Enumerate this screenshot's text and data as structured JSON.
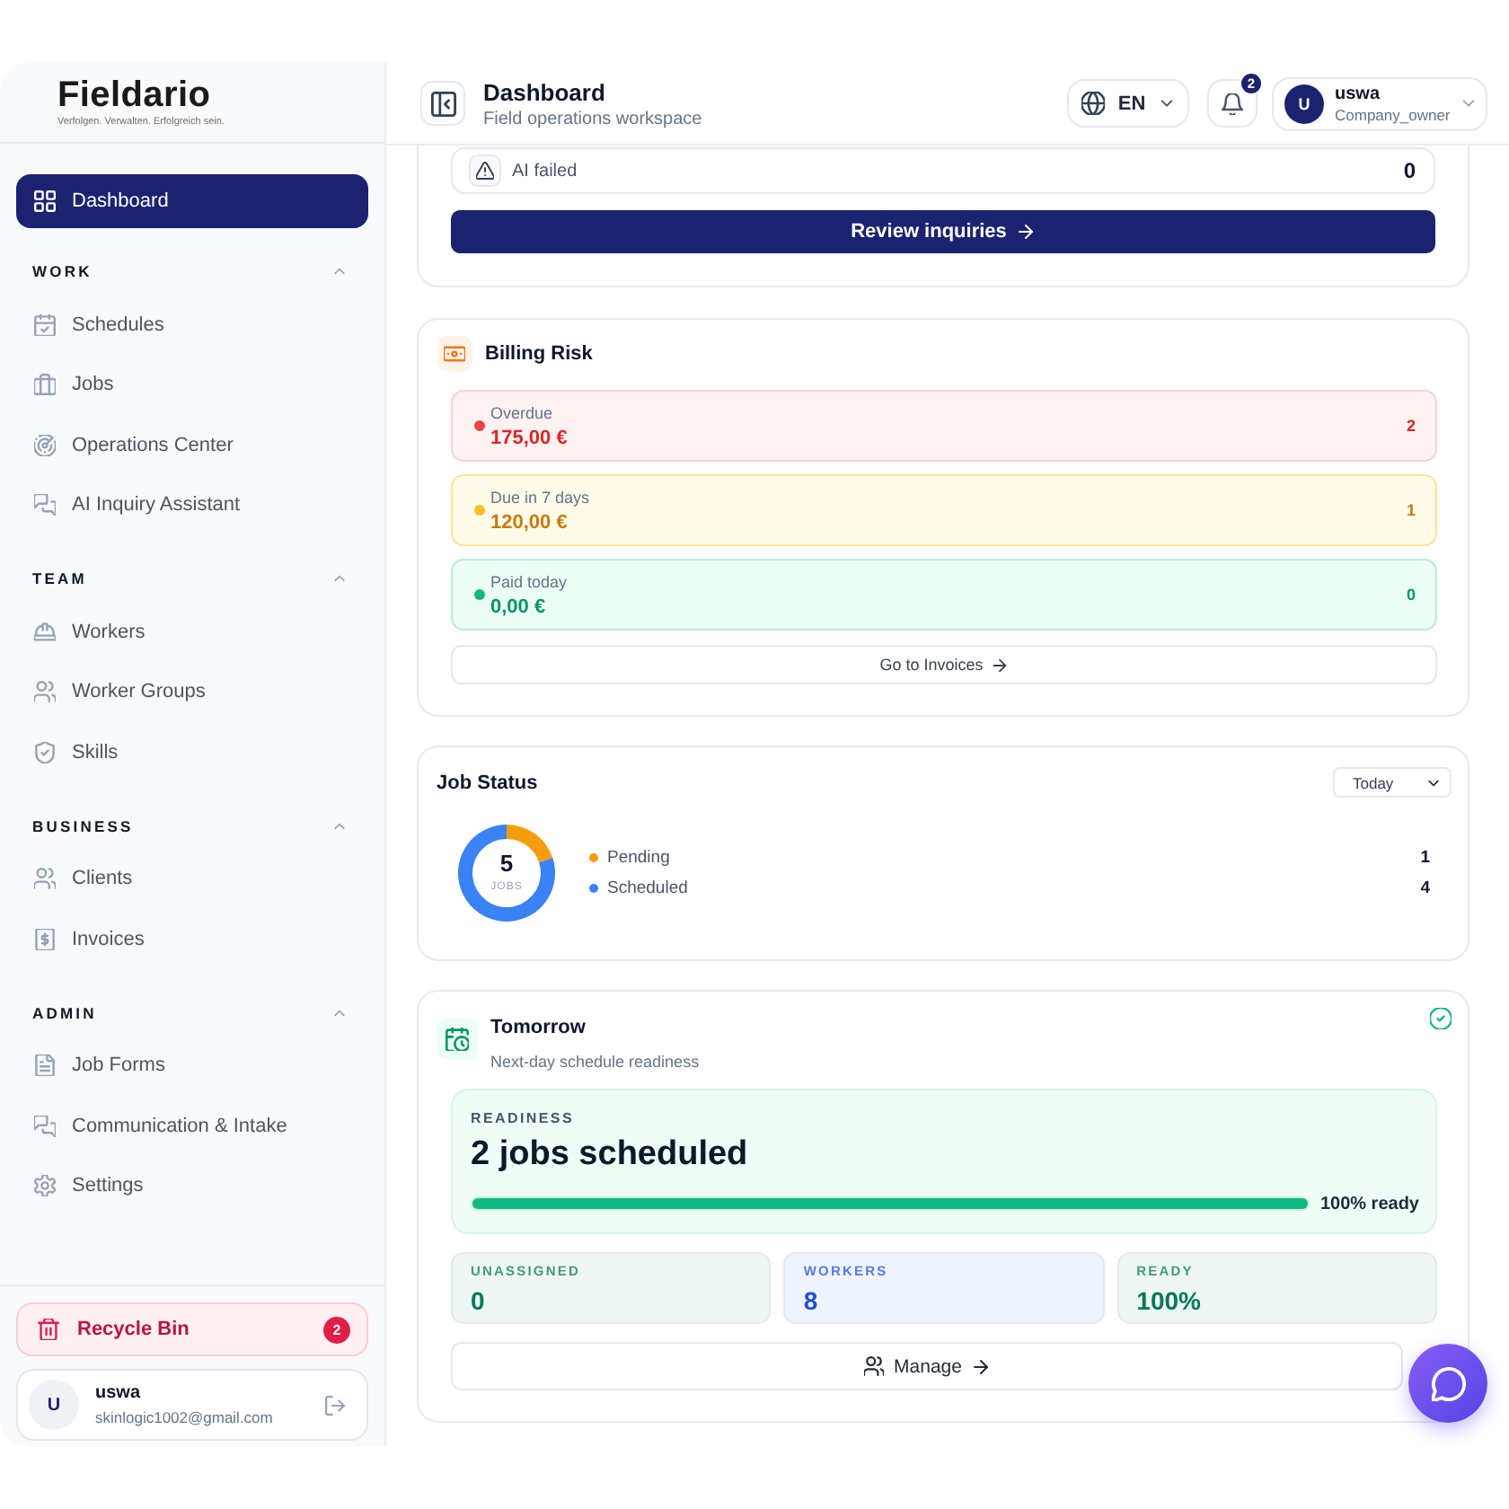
{
  "sidebar": {
    "logo": {
      "name": "Fieldario",
      "tagline": "Verfolgen. Verwalten. Erfolgreich sein."
    },
    "home": {
      "label": "Dashboard",
      "selected": true
    },
    "sections": [
      {
        "title": "WORK",
        "expanded": true,
        "items": [
          {
            "label": "Schedules",
            "selected": false
          },
          {
            "label": "Jobs",
            "selected": false
          },
          {
            "label": "Operations Center",
            "selected": false
          },
          {
            "label": "AI Inquiry Assistant",
            "selected": false
          }
        ]
      },
      {
        "title": "TEAM",
        "expanded": true,
        "items": [
          {
            "label": "Workers",
            "selected": false
          },
          {
            "label": "Worker Groups",
            "selected": false
          },
          {
            "label": "Skills",
            "selected": false
          }
        ]
      },
      {
        "title": "BUSINESS",
        "expanded": true,
        "items": [
          {
            "label": "Clients",
            "selected": false
          },
          {
            "label": "Invoices",
            "selected": false
          }
        ]
      },
      {
        "title": "ADMIN",
        "expanded": true,
        "items": [
          {
            "label": "Job Forms",
            "selected": false
          },
          {
            "label": "Communication & Intake",
            "selected": false
          },
          {
            "label": "Settings",
            "selected": false
          }
        ]
      }
    ],
    "recycle_bin": {
      "label": "Recycle Bin",
      "count": "2"
    },
    "user": {
      "initial": "U",
      "name": "uswa",
      "email": "skinlogic1002@gmail.com"
    }
  },
  "header": {
    "title": "Dashboard",
    "subtitle": "Field operations workspace",
    "language": "EN",
    "notification_count": "2",
    "user": {
      "initial": "U",
      "name": "uswa",
      "role": "Company_owner"
    }
  },
  "inquiries": {
    "rows": [
      {
        "label": "AI failed",
        "count": "0"
      }
    ],
    "button": "Review inquiries"
  },
  "billing_risk": {
    "title": "Billing Risk",
    "items": [
      {
        "kind": "danger",
        "color": "#ef4444",
        "label": "Overdue",
        "amount": "175,00 €",
        "count": "2"
      },
      {
        "kind": "warning",
        "color": "#fbbf24",
        "label": "Due in 7 days",
        "amount": "120,00 €",
        "count": "1"
      },
      {
        "kind": "success",
        "color": "#10b981",
        "label": "Paid today",
        "amount": "0,00 €",
        "count": "0"
      }
    ],
    "link": "Go to Invoices"
  },
  "job_status": {
    "title": "Job Status",
    "period": "Today",
    "total": "5",
    "total_label": "JOBS",
    "legend": [
      {
        "color": "#f59e0b",
        "count": "1"
      },
      {
        "color": "#3b82f6",
        "count": "4"
      }
    ],
    "chart_data": {
      "type": "donut",
      "categories": [
        "Pending",
        "Scheduled"
      ],
      "values": [
        20,
        80
      ]
    }
  },
  "tomorrow": {
    "title": "Tomorrow",
    "subtitle": "Next-day schedule readiness",
    "readiness": {
      "label": "READINESS",
      "headline": "2 jobs scheduled",
      "level": 1,
      "reading": "100% ready"
    },
    "stats": [
      {
        "label": "UNASSIGNED",
        "value": "0",
        "color": "#047857"
      },
      {
        "label": "WORKERS",
        "value": "8",
        "color": "#1d4ed8"
      },
      {
        "label": "READY",
        "value": "100%",
        "color": "#047857"
      }
    ],
    "button": "Manage"
  }
}
